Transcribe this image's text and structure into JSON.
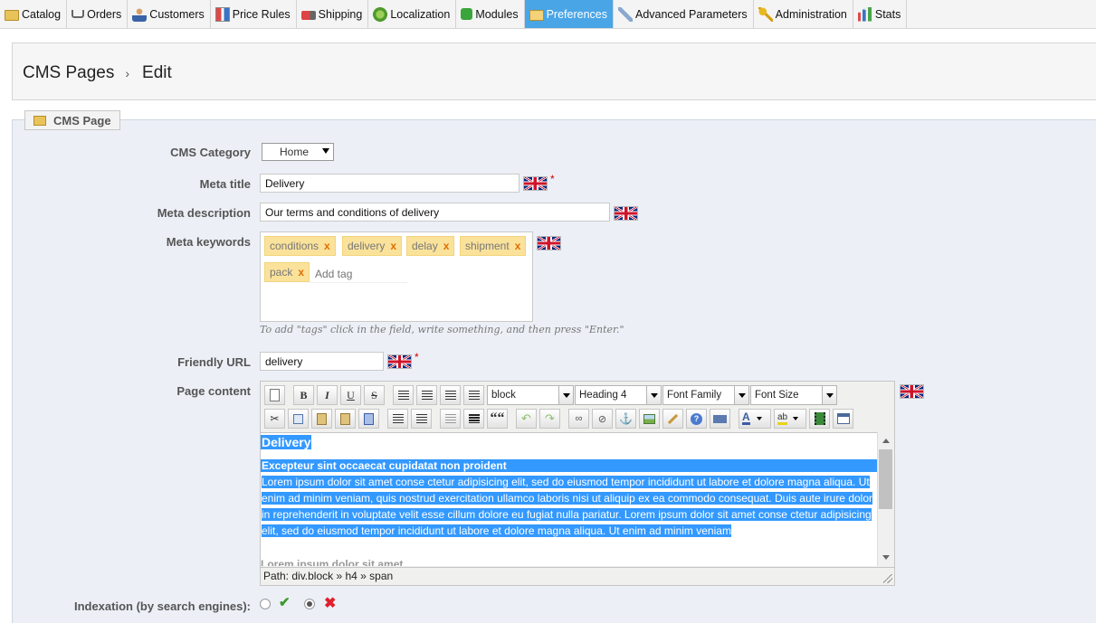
{
  "nav": {
    "tabs": [
      {
        "label": "Catalog",
        "icon": "folder-icon"
      },
      {
        "label": "Orders",
        "icon": "cart-icon"
      },
      {
        "label": "Customers",
        "icon": "person-icon"
      },
      {
        "label": "Price Rules",
        "icon": "price-icon"
      },
      {
        "label": "Shipping",
        "icon": "truck-icon"
      },
      {
        "label": "Localization",
        "icon": "globe-icon"
      },
      {
        "label": "Modules",
        "icon": "puzzle-icon"
      },
      {
        "label": "Preferences",
        "icon": "preferences-icon",
        "active": true
      },
      {
        "label": "Advanced Parameters",
        "icon": "wrench-icon"
      },
      {
        "label": "Administration",
        "icon": "key-icon"
      },
      {
        "label": "Stats",
        "icon": "stats-icon"
      }
    ]
  },
  "breadcrumb": {
    "section": "CMS Pages",
    "separator": "›",
    "current": "Edit"
  },
  "panel": {
    "legend": "CMS Page"
  },
  "form": {
    "cms_category": {
      "label": "CMS Category",
      "value": "Home"
    },
    "meta_title": {
      "label": "Meta title",
      "value": "Delivery",
      "required": "*"
    },
    "meta_description": {
      "label": "Meta description",
      "value": "Our terms and conditions of delivery"
    },
    "meta_keywords": {
      "label": "Meta keywords",
      "tags": [
        "conditions",
        "delivery",
        "delay",
        "shipment",
        "pack"
      ],
      "remove_glyph": "x",
      "add_placeholder": "Add tag",
      "hint": "To add \"tags\" click in the field, write something, and then press \"Enter.\""
    },
    "friendly_url": {
      "label": "Friendly URL",
      "value": "delivery",
      "required": "*"
    },
    "page_content": {
      "label": "Page content",
      "format_select": "block",
      "style_select": "Heading 4",
      "font_family_select": "Font Family",
      "font_size_select": "Font Size",
      "heading": "Delivery",
      "subheading": "Excepteur sint occaecat cupidatat non proident",
      "paragraph": "Lorem ipsum dolor sit amet conse ctetur adipisicing elit, sed do eiusmod tempor incididunt ut labore et dolore magna aliqua. Ut enim ad minim veniam, quis nostrud exercitation ullamco laboris nisi ut aliquip ex ea commodo consequat. Duis aute irure dolor in reprehenderit in voluptate velit esse cillum dolore eu fugiat nulla pariatur. Lorem ipsum dolor sit amet conse ctetur adipisicing elit, sed do eiusmod tempor incididunt ut labore et dolore magna aliqua. Ut enim ad minim veniam",
      "next_line": "Lorem ipsum dolor sit amet",
      "path": "Path: div.block » h4 » span"
    },
    "indexation": {
      "label": "Indexation (by search engines):",
      "selected": "no"
    }
  },
  "toolbar": {
    "bold": "B",
    "italic": "I",
    "underline": "U",
    "strike": "S",
    "blockquote": "““"
  }
}
